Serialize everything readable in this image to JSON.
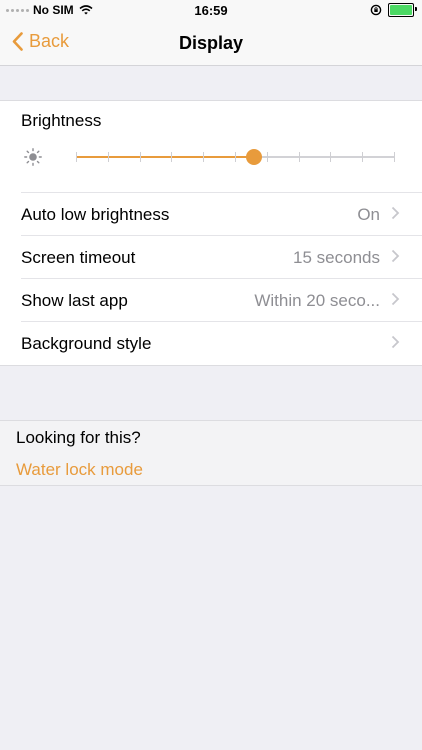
{
  "status_bar": {
    "carrier": "No SIM",
    "time": "16:59",
    "signal_icon": "signal-dots-icon",
    "wifi_icon": "wifi-icon",
    "rotation_lock_icon": "rotation-lock-icon",
    "battery_icon": "battery-charging-icon",
    "battery_color": "#4cd964"
  },
  "nav": {
    "back_label": "Back",
    "title": "Display",
    "accent_color": "#e89b3c"
  },
  "brightness": {
    "label": "Brightness",
    "icon": "sun-icon",
    "level_percent": 56,
    "step_count": 10
  },
  "settings": [
    {
      "label": "Auto low brightness",
      "value": "On"
    },
    {
      "label": "Screen timeout",
      "value": "15 seconds"
    },
    {
      "label": "Show last app",
      "value": "Within 20 seco..."
    },
    {
      "label": "Background style",
      "value": ""
    }
  ],
  "looking": {
    "title": "Looking for this?",
    "link": "Water lock mode"
  }
}
